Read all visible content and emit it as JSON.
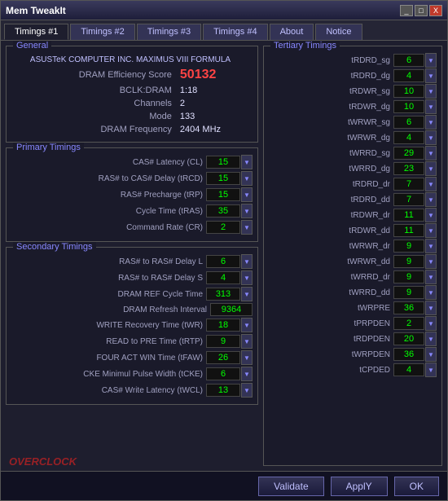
{
  "window": {
    "title": "Mem TweakIt",
    "minimize_label": "_",
    "maximize_label": "□",
    "close_label": "X"
  },
  "tabs": [
    {
      "label": "Timings #1",
      "active": true
    },
    {
      "label": "Timings #2",
      "active": false
    },
    {
      "label": "Timings #3",
      "active": false
    },
    {
      "label": "Timings #4",
      "active": false
    },
    {
      "label": "About",
      "active": false
    },
    {
      "label": "Notice",
      "active": false
    }
  ],
  "general": {
    "title": "General",
    "motherboard_label": "ASUSTeK COMPUTER INC. MAXIMUS VIII FORMULA",
    "dram_score_label": "DRAM Efficiency Score",
    "dram_score_value": "50132",
    "bclk_label": "BCLK:DRAM",
    "bclk_value": "1:18",
    "channels_label": "Channels",
    "channels_value": "2",
    "mode_label": "Mode",
    "mode_value": "133",
    "freq_label": "DRAM Frequency",
    "freq_value": "2404 MHz"
  },
  "primary": {
    "title": "Primary Timings",
    "rows": [
      {
        "label": "CAS# Latency (CL)",
        "value": "15"
      },
      {
        "label": "RAS# to CAS# Delay (tRCD)",
        "value": "15"
      },
      {
        "label": "RAS# Precharge (tRP)",
        "value": "15"
      },
      {
        "label": "Cycle Time (tRAS)",
        "value": "35"
      },
      {
        "label": "Command Rate (CR)",
        "value": "2"
      }
    ]
  },
  "secondary": {
    "title": "Secondary Timings",
    "rows": [
      {
        "label": "RAS# to RAS# Delay L",
        "value": "6"
      },
      {
        "label": "RAS# to RAS# Delay S",
        "value": "4"
      },
      {
        "label": "DRAM REF Cycle Time",
        "value": "313"
      },
      {
        "label": "DRAM Refresh Interval",
        "value": "9364",
        "wide": true
      },
      {
        "label": "WRITE Recovery Time (tWR)",
        "value": "18"
      },
      {
        "label": "READ to PRE Time (tRTP)",
        "value": "9"
      },
      {
        "label": "FOUR ACT WIN Time (tFAW)",
        "value": "26"
      },
      {
        "label": "CKE Minimul Pulse Width (tCKE)",
        "value": "6"
      },
      {
        "label": "CAS# Write Latency (tWCL)",
        "value": "13"
      }
    ]
  },
  "tertiary": {
    "title": "Tertiary Timings",
    "rows": [
      {
        "label": "tRDRD_sg",
        "value": "6"
      },
      {
        "label": "tRDRD_dg",
        "value": "4"
      },
      {
        "label": "tRDWR_sg",
        "value": "10"
      },
      {
        "label": "tRDWR_dg",
        "value": "10"
      },
      {
        "label": "tWRWR_sg",
        "value": "6"
      },
      {
        "label": "tWRWR_dg",
        "value": "4"
      },
      {
        "label": "tWRRD_sg",
        "value": "29"
      },
      {
        "label": "tWRRD_dg",
        "value": "23"
      },
      {
        "label": "tRDRD_dr",
        "value": "7"
      },
      {
        "label": "tRDRD_dd",
        "value": "7"
      },
      {
        "label": "tRDWR_dr",
        "value": "11"
      },
      {
        "label": "tRDWR_dd",
        "value": "11"
      },
      {
        "label": "tWRWR_dr",
        "value": "9"
      },
      {
        "label": "tWRWR_dd",
        "value": "9"
      },
      {
        "label": "tWRRD_dr",
        "value": "9"
      },
      {
        "label": "tWRRD_dd",
        "value": "9"
      },
      {
        "label": "tWRPRE",
        "value": "36"
      },
      {
        "label": "tPRPDEN",
        "value": "2"
      },
      {
        "label": "tRDPDEN",
        "value": "20"
      },
      {
        "label": "tWRPDEN",
        "value": "36"
      },
      {
        "label": "tCPDED",
        "value": "4"
      }
    ]
  },
  "buttons": {
    "validate": "Validate",
    "apply": "ApplY",
    "ok": "OK"
  },
  "watermark": "OVERCLOCK"
}
